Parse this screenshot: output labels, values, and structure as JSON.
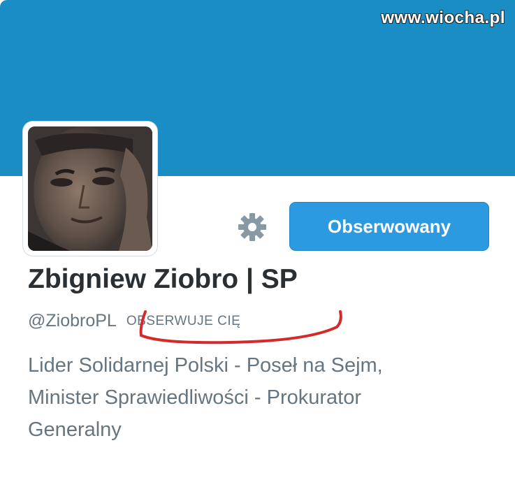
{
  "watermark": "www.wiocha.pl",
  "profile": {
    "name": "Zbigniew Ziobro | SP",
    "handle": "@ZiobroPL",
    "follows_you_badge": "OBSERWUJE CIĘ",
    "bio_lines": [
      "Lider Solidarnej Polski - Poseł na Sejm,",
      "Minister Sprawiedliwości - Prokurator",
      "Generalny"
    ]
  },
  "actions": {
    "follow_button_label": "Obserwowany",
    "settings_icon": "gear-icon"
  },
  "colors": {
    "header": "#1a8dc5",
    "follow_button": "#2b9ae0",
    "annotation": "#d42a2a"
  }
}
